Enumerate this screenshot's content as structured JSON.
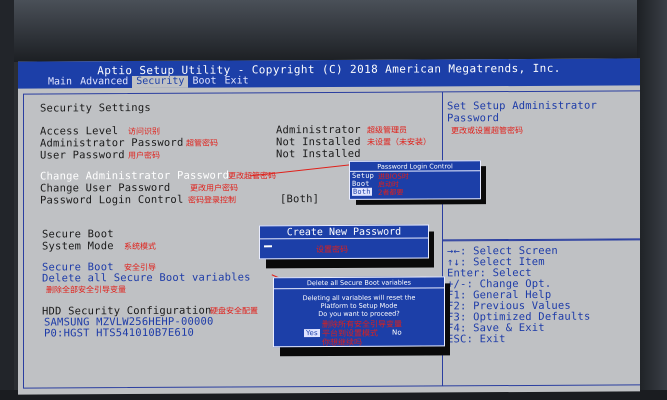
{
  "title": "Aptio Setup Utility - Copyright (C) 2018 American Megatrends, Inc.",
  "tabs": [
    "Main",
    "Advanced",
    "Security",
    "Boot",
    "Exit"
  ],
  "active_tab": "Security",
  "section_title": "Security Settings",
  "rows": {
    "access_level": {
      "label": "Access Level",
      "note": "访问识别",
      "value": "Administrator",
      "value_note": "超级管理员"
    },
    "admin_password": {
      "label": "Administrator Password",
      "note": "超管密码",
      "value": "Not Installed",
      "value_note": "未设置（未安装）"
    },
    "user_password": {
      "label": "User Password",
      "note": "用户密码",
      "value": "Not Installed"
    },
    "change_admin": {
      "label": "Change Administrator Password",
      "note": "更改超管密码"
    },
    "change_user": {
      "label": "Change User Password",
      "note": "更改用户密码"
    },
    "pwd_login_control": {
      "label": "Password Login Control",
      "note": "密码登录控制",
      "value": "[Both]"
    },
    "secure_boot": {
      "label": "Secure Boot"
    },
    "system_mode": {
      "label": "System Mode",
      "note": "系统模式"
    },
    "secure_boot_link": {
      "label": "Secure Boot",
      "note": "安全引导"
    },
    "delete_all": {
      "label": "Delete all Secure Boot variables",
      "note": "删除全部安全引导变量"
    },
    "hdd_config": {
      "label": "HDD Security Configuration",
      "note": "硬盘安全配置"
    },
    "hdd1": {
      "label": "SAMSUNG MZVLW256HEHP-00000"
    },
    "hdd2": {
      "label": "P0:HGST HTS541010B7E610"
    }
  },
  "help_text": [
    "Set Setup Administrator",
    "Password"
  ],
  "help_note": "更改或设置超管密码",
  "keys": [
    "→←: Select Screen",
    "↑↓: Select Item",
    "Enter: Select",
    "+/-: Change Opt.",
    "F1: General Help",
    "F2: Previous Values",
    "F3: Optimized Defaults",
    "F4: Save & Exit",
    "ESC: Exit"
  ],
  "pwd_popup": {
    "title": "Password Login Control",
    "options": [
      {
        "label": "Setup",
        "note": "进BIOS时"
      },
      {
        "label": "Boot",
        "note": "启动时"
      },
      {
        "label": "Both",
        "note": "2者都要"
      }
    ],
    "selected": "Both"
  },
  "create_pwd": {
    "title": "Create New Password",
    "note": "设置密码"
  },
  "delete_dialog": {
    "title": "Delete all Secure Boot variables",
    "lines": [
      "Deleting all variables will reset the",
      "Platform to Setup Mode",
      "Do you want to proceed?"
    ],
    "line_note": "删除所有安全引导变量",
    "yes": "Yes",
    "no": "No",
    "yes_note1": "平台到设置模式",
    "yes_note2": "你想继续吗"
  },
  "colors": {
    "bios_blue": "#1c3fa8",
    "bios_grey": "#bfc1c4",
    "annotation_red": "#e0201a"
  }
}
